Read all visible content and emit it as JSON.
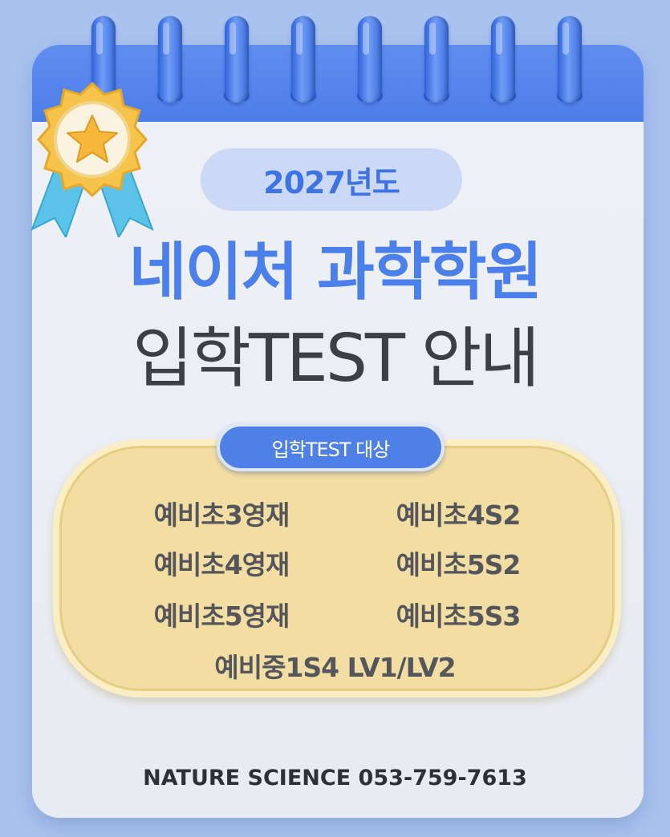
{
  "poster": {
    "year": "2027년도",
    "title": "네이처 과학학원",
    "subtitle": "입학TEST 안내",
    "target_label": "입학TEST 대상",
    "grades": [
      "예비초3영재",
      "예비초4S2",
      "예비초4영재",
      "예비초5S2",
      "예비초5영재",
      "예비초5S3",
      "예비중1S4 LV1/LV2"
    ],
    "footer": "NATURE SCIENCE  053-759-7613"
  },
  "colors": {
    "background": "#a9c2ef",
    "accent_blue": "#4b7fe9",
    "target_box": "#f2dea2"
  },
  "icons": [
    "spiral-ring-icon",
    "medal-star-icon"
  ]
}
